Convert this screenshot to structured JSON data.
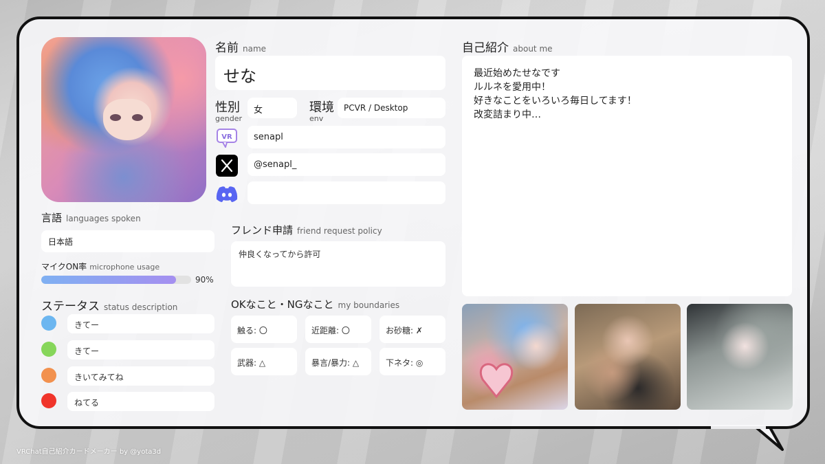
{
  "name": {
    "label_jp": "名前",
    "label_en": "name",
    "value": "せな"
  },
  "gender": {
    "label_jp": "性別",
    "label_en": "gender",
    "value": "女"
  },
  "env": {
    "label_jp": "環境",
    "label_en": "env",
    "value": "PCVR / Desktop"
  },
  "vrchat": {
    "icon": "vrchat-icon",
    "value": "senapl"
  },
  "x": {
    "icon": "x-logo-icon",
    "value": "@senapl_"
  },
  "discord": {
    "icon": "discord-icon",
    "value": ""
  },
  "languages": {
    "label_jp": "言語",
    "label_en": "languages spoken",
    "value": "日本語"
  },
  "mic": {
    "label_jp": "マイクON率",
    "label_en": "microphone usage",
    "value": "90%",
    "fraction": 0.9
  },
  "status": {
    "label_jp": "ステータス",
    "label_en": "status description",
    "items": [
      {
        "color": "#6cb6f0",
        "text": "きてー"
      },
      {
        "color": "#86d65a",
        "text": "きてー"
      },
      {
        "color": "#f2914e",
        "text": "きいてみてね"
      },
      {
        "color": "#f0342a",
        "text": "ねてる"
      }
    ]
  },
  "friend": {
    "label_jp": "フレンド申請",
    "label_en": "friend request policy",
    "value": "仲良くなってから許可"
  },
  "boundaries": {
    "label_jp": "OKなこと・NGなこと",
    "label_en": "my boundaries",
    "items": [
      "触る: 〇",
      "近距離: 〇",
      "お砂糖: ✗",
      "武器: △",
      "暴言/暴力: △",
      "下ネタ: ◎"
    ]
  },
  "about": {
    "label_jp": "自己紹介",
    "label_en": "about me",
    "lines": [
      "最近始めたせなです",
      "ルルネを愛用中！",
      "好きなことをいろいろ毎日してます！",
      "改変詰まり中…"
    ]
  },
  "footer": "VRChat自己紹介カードメーカー by @yota3d",
  "colors": {
    "border": "#111111",
    "mic_bar_start": "#7fb0f2",
    "mic_bar_end": "#a58ff0"
  }
}
